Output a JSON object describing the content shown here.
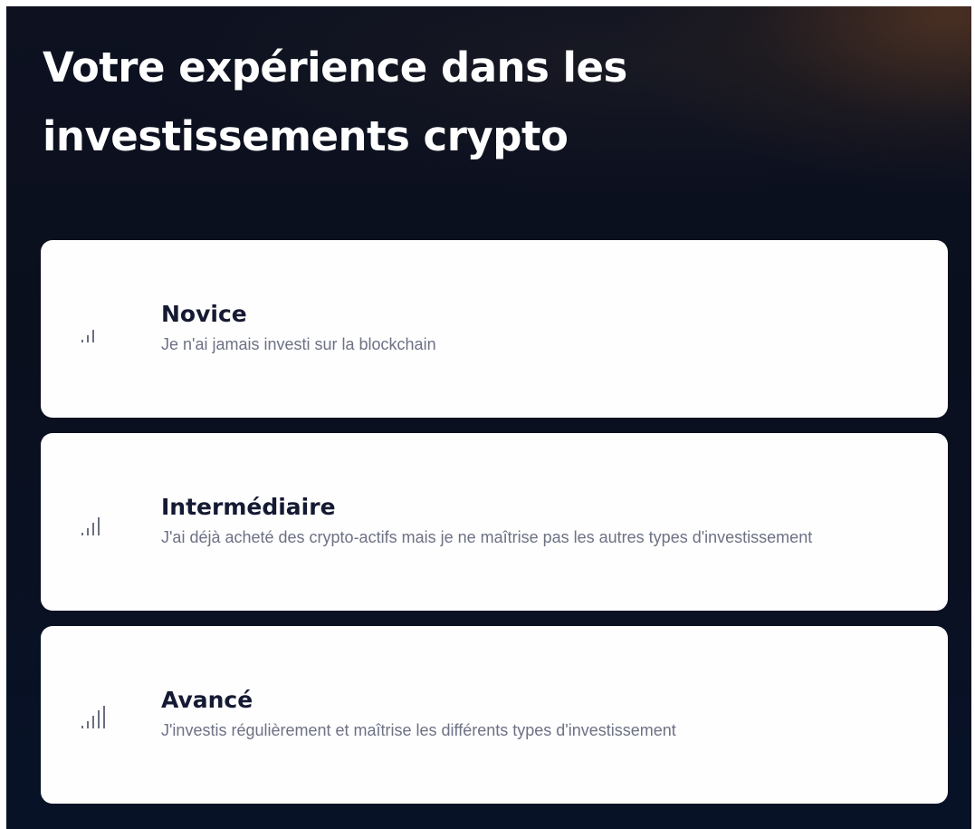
{
  "page": {
    "title": "Votre expérience dans les investissements crypto"
  },
  "options": [
    {
      "title": "Novice",
      "description": "Je n'ai jamais investi sur la blockchain",
      "icon": "signal-low-icon",
      "signal_level": 2
    },
    {
      "title": "Intermédiaire",
      "description": "J'ai déjà acheté des crypto-actifs mais je ne maîtrise pas les autres types d'investissement",
      "icon": "signal-medium-icon",
      "signal_level": 3
    },
    {
      "title": "Avancé",
      "description": "J'investis régulièrement et maîtrise les différents types d'investissement",
      "icon": "signal-high-icon",
      "signal_level": 4
    }
  ],
  "colors": {
    "background": "#0a0f1e",
    "card": "#fefefe",
    "title_text": "#ffffff",
    "card_title_text": "#151a33",
    "card_desc_text": "#6d7184",
    "icon": "#6b6f80"
  }
}
